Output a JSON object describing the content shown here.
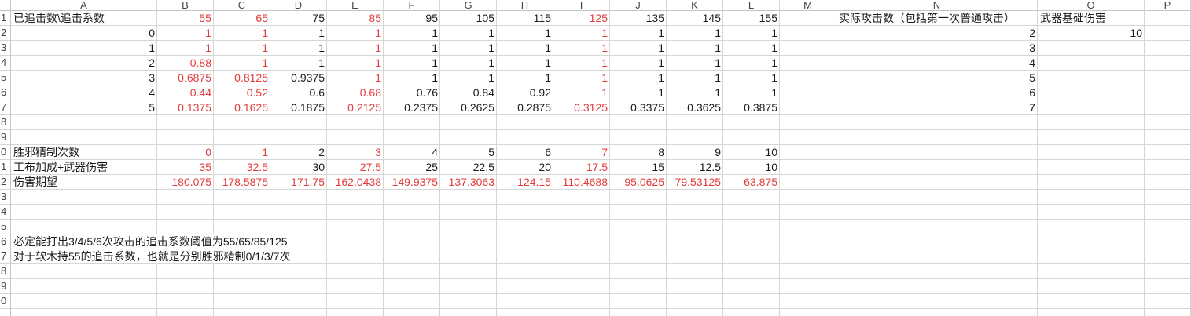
{
  "colors": {
    "red_text": "#e33b3b",
    "cell_text": "#1a1a1a",
    "gridline": "#d6d6d6",
    "header_text": "#444444",
    "background": "#ffffff"
  },
  "sheet": {
    "columns": [
      "A",
      "B",
      "C",
      "D",
      "E",
      "F",
      "G",
      "H",
      "I",
      "J",
      "K",
      "L",
      "M",
      "N",
      "O",
      "P"
    ],
    "row_headers": [
      "1",
      "2",
      "3",
      "4",
      "5",
      "6",
      "7",
      "8",
      "9",
      "0",
      "1",
      "2",
      "3",
      "4",
      "5",
      "6",
      "7",
      "8",
      "9",
      "0"
    ],
    "rows": [
      {
        "cells": {
          "A": "已追击数\\追击系数",
          "B": "55",
          "C": "65",
          "D": "75",
          "E": "85",
          "F": "95",
          "G": "105",
          "H": "115",
          "I": "125",
          "J": "135",
          "K": "145",
          "L": "155",
          "N": "实际攻击数（包括第一次普通攻击）",
          "O": "武器基础伤害"
        },
        "red": [
          "B",
          "C",
          "E",
          "I"
        ]
      },
      {
        "cells": {
          "A": "0",
          "B": "1",
          "C": "1",
          "D": "1",
          "E": "1",
          "F": "1",
          "G": "1",
          "H": "1",
          "I": "1",
          "J": "1",
          "K": "1",
          "L": "1",
          "N": "2",
          "O": "10"
        },
        "red": [
          "B",
          "C",
          "E",
          "I"
        ]
      },
      {
        "cells": {
          "A": "1",
          "B": "1",
          "C": "1",
          "D": "1",
          "E": "1",
          "F": "1",
          "G": "1",
          "H": "1",
          "I": "1",
          "J": "1",
          "K": "1",
          "L": "1",
          "N": "3"
        },
        "red": [
          "B",
          "C",
          "E",
          "I"
        ]
      },
      {
        "cells": {
          "A": "2",
          "B": "0.88",
          "C": "1",
          "D": "1",
          "E": "1",
          "F": "1",
          "G": "1",
          "H": "1",
          "I": "1",
          "J": "1",
          "K": "1",
          "L": "1",
          "N": "4"
        },
        "red": [
          "B",
          "C",
          "E",
          "I"
        ]
      },
      {
        "cells": {
          "A": "3",
          "B": "0.6875",
          "C": "0.8125",
          "D": "0.9375",
          "E": "1",
          "F": "1",
          "G": "1",
          "H": "1",
          "I": "1",
          "J": "1",
          "K": "1",
          "L": "1",
          "N": "5"
        },
        "red": [
          "B",
          "C",
          "E",
          "I"
        ]
      },
      {
        "cells": {
          "A": "4",
          "B": "0.44",
          "C": "0.52",
          "D": "0.6",
          "E": "0.68",
          "F": "0.76",
          "G": "0.84",
          "H": "0.92",
          "I": "1",
          "J": "1",
          "K": "1",
          "L": "1",
          "N": "6"
        },
        "red": [
          "B",
          "C",
          "E",
          "I"
        ]
      },
      {
        "cells": {
          "A": "5",
          "B": "0.1375",
          "C": "0.1625",
          "D": "0.1875",
          "E": "0.2125",
          "F": "0.2375",
          "G": "0.2625",
          "H": "0.2875",
          "I": "0.3125",
          "J": "0.3375",
          "K": "0.3625",
          "L": "0.3875",
          "N": "7"
        },
        "red": [
          "B",
          "C",
          "E",
          "I"
        ]
      },
      {
        "cells": {}
      },
      {
        "cells": {}
      },
      {
        "cells": {
          "A": "胜邪精制次数",
          "B": "0",
          "C": "1",
          "D": "2",
          "E": "3",
          "F": "4",
          "G": "5",
          "H": "6",
          "I": "7",
          "J": "8",
          "K": "9",
          "L": "10"
        },
        "red": [
          "B",
          "C",
          "E",
          "I"
        ]
      },
      {
        "cells": {
          "A": "工布加成+武器伤害",
          "B": "35",
          "C": "32.5",
          "D": "30",
          "E": "27.5",
          "F": "25",
          "G": "22.5",
          "H": "20",
          "I": "17.5",
          "J": "15",
          "K": "12.5",
          "L": "10"
        },
        "red": [
          "B",
          "C",
          "E",
          "I"
        ]
      },
      {
        "cells": {
          "A": "伤害期望",
          "B": "180.075",
          "C": "178.5875",
          "D": "171.75",
          "E": "162.0438",
          "F": "149.9375",
          "G": "137.3063",
          "H": "124.15",
          "I": "110.4688",
          "J": "95.0625",
          "K": "79.53125",
          "L": "63.875"
        },
        "red": [
          "B",
          "C",
          "D",
          "E",
          "F",
          "G",
          "H",
          "I",
          "J",
          "K",
          "L"
        ]
      },
      {
        "cells": {}
      },
      {
        "cells": {}
      },
      {
        "cells": {}
      },
      {
        "cells": {
          "A": "必定能打出3/4/5/6次攻击的追击系数阈值为55/65/85/125"
        }
      },
      {
        "cells": {
          "A": "对于软木持55的追击系数，也就是分别胜邪精制0/1/3/7次"
        }
      },
      {
        "cells": {}
      },
      {
        "cells": {}
      },
      {
        "cells": {}
      }
    ]
  }
}
